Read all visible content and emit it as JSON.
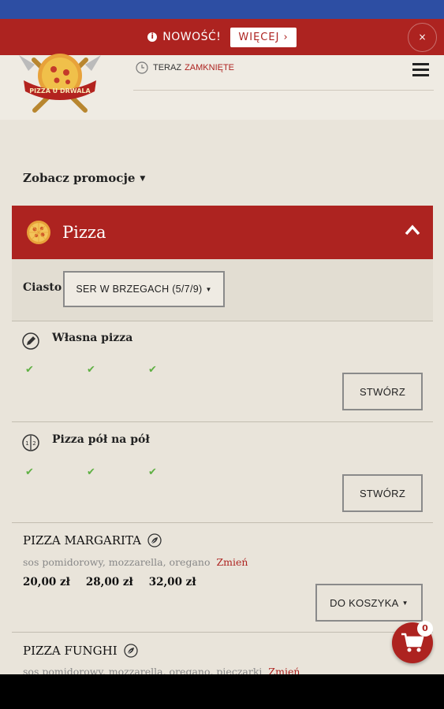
{
  "notice": {
    "text": "NOWOŚĆ!",
    "more": "WIĘCEJ ›",
    "close": "×"
  },
  "header": {
    "logo_text": "PIZZA U DRWALA",
    "hours_prefix": "TERAZ",
    "hours_status": "ZAMKNIĘTE"
  },
  "promo": {
    "label": "Zobacz promocje"
  },
  "category": {
    "title": "Pizza"
  },
  "crust": {
    "label": "Ciasto",
    "selected": "SER W BRZEGACH (5/7/9)"
  },
  "custom_items": [
    {
      "title": "Własna pizza",
      "button": "STWÓRZ"
    },
    {
      "title": "Pizza pół na pół",
      "button": "STWÓRZ"
    }
  ],
  "products": [
    {
      "name": "PIZZA MARGARITA",
      "ingredients": "sos pomidorowy, mozzarella, oregano",
      "change": "Zmień",
      "prices": [
        "20,00 zł",
        "28,00 zł",
        "32,00 zł"
      ],
      "button": "DO KOSZYKA"
    },
    {
      "name": "PIZZA FUNGHI",
      "ingredients": "sos pomidorowy, mozzarella, oregano, pieczarki",
      "change": "Zmień"
    }
  ],
  "cart": {
    "count": "0"
  },
  "colors": {
    "accent": "#ad2320",
    "background": "#e9e4da",
    "status_bar": "#2d4ea3",
    "check": "#5fb043"
  }
}
